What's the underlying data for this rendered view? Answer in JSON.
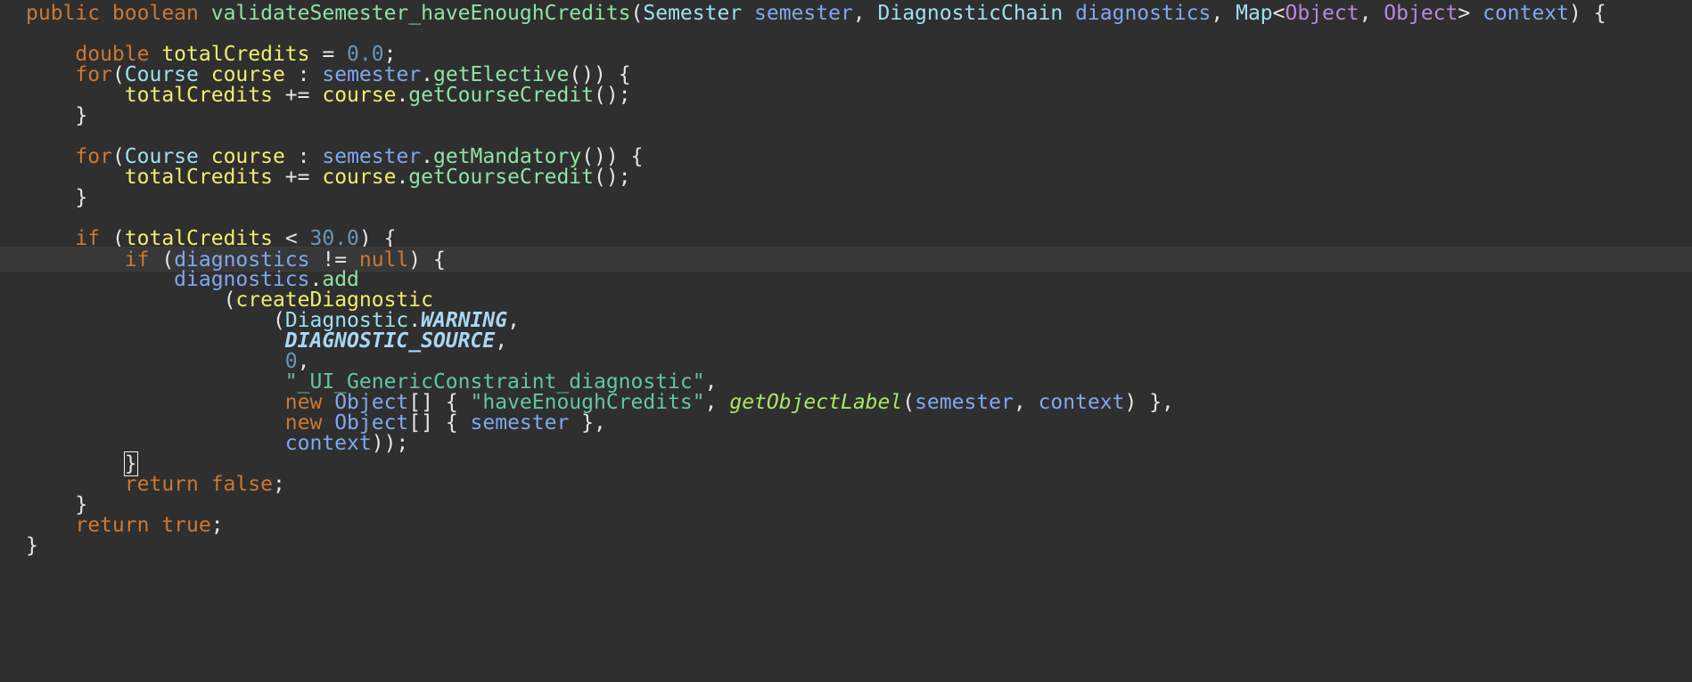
{
  "editor": {
    "lines": [
      {
        "current": false,
        "tokens": [
          {
            "t": "public boolean ",
            "c": "kw"
          },
          {
            "t": "validateSemester_haveEnoughCredits",
            "c": "meth"
          },
          {
            "t": "(",
            "c": "punc"
          },
          {
            "t": "Semester ",
            "c": "type"
          },
          {
            "t": "semester",
            "c": "param"
          },
          {
            "t": ", ",
            "c": "punc"
          },
          {
            "t": "DiagnosticChain ",
            "c": "type"
          },
          {
            "t": "diagnostics",
            "c": "param"
          },
          {
            "t": ", ",
            "c": "punc"
          },
          {
            "t": "Map",
            "c": "type"
          },
          {
            "t": "<",
            "c": "punc"
          },
          {
            "t": "Object",
            "c": "gen"
          },
          {
            "t": ", ",
            "c": "punc"
          },
          {
            "t": "Object",
            "c": "gen"
          },
          {
            "t": "> ",
            "c": "punc"
          },
          {
            "t": "context",
            "c": "param"
          },
          {
            "t": ") {",
            "c": "punc"
          }
        ]
      },
      {
        "current": false,
        "tokens": []
      },
      {
        "current": false,
        "tokens": [
          {
            "t": "    ",
            "c": "plain"
          },
          {
            "t": "double ",
            "c": "kw"
          },
          {
            "t": "totalCredits",
            "c": "var"
          },
          {
            "t": " = ",
            "c": "punc"
          },
          {
            "t": "0.0",
            "c": "num"
          },
          {
            "t": ";",
            "c": "punc"
          }
        ]
      },
      {
        "current": false,
        "tokens": [
          {
            "t": "    ",
            "c": "plain"
          },
          {
            "t": "for",
            "c": "kw"
          },
          {
            "t": "(",
            "c": "punc"
          },
          {
            "t": "Course ",
            "c": "type"
          },
          {
            "t": "course",
            "c": "var"
          },
          {
            "t": " : ",
            "c": "punc"
          },
          {
            "t": "semester",
            "c": "param"
          },
          {
            "t": ".",
            "c": "punc"
          },
          {
            "t": "getElective",
            "c": "meth"
          },
          {
            "t": "()) {",
            "c": "punc"
          }
        ]
      },
      {
        "current": false,
        "tokens": [
          {
            "t": "        ",
            "c": "plain"
          },
          {
            "t": "totalCredits",
            "c": "var"
          },
          {
            "t": " += ",
            "c": "punc"
          },
          {
            "t": "course",
            "c": "var"
          },
          {
            "t": ".",
            "c": "punc"
          },
          {
            "t": "getCourseCredit",
            "c": "meth"
          },
          {
            "t": "();",
            "c": "punc"
          }
        ]
      },
      {
        "current": false,
        "tokens": [
          {
            "t": "    }",
            "c": "punc"
          }
        ]
      },
      {
        "current": false,
        "tokens": []
      },
      {
        "current": false,
        "tokens": [
          {
            "t": "    ",
            "c": "plain"
          },
          {
            "t": "for",
            "c": "kw"
          },
          {
            "t": "(",
            "c": "punc"
          },
          {
            "t": "Course ",
            "c": "type"
          },
          {
            "t": "course",
            "c": "var"
          },
          {
            "t": " : ",
            "c": "punc"
          },
          {
            "t": "semester",
            "c": "param"
          },
          {
            "t": ".",
            "c": "punc"
          },
          {
            "t": "getMandatory",
            "c": "meth"
          },
          {
            "t": "()) {",
            "c": "punc"
          }
        ]
      },
      {
        "current": false,
        "tokens": [
          {
            "t": "        ",
            "c": "plain"
          },
          {
            "t": "totalCredits",
            "c": "var"
          },
          {
            "t": " += ",
            "c": "punc"
          },
          {
            "t": "course",
            "c": "var"
          },
          {
            "t": ".",
            "c": "punc"
          },
          {
            "t": "getCourseCredit",
            "c": "meth"
          },
          {
            "t": "();",
            "c": "punc"
          }
        ]
      },
      {
        "current": false,
        "tokens": [
          {
            "t": "    }",
            "c": "punc"
          }
        ]
      },
      {
        "current": false,
        "tokens": []
      },
      {
        "current": false,
        "tokens": [
          {
            "t": "    ",
            "c": "plain"
          },
          {
            "t": "if",
            "c": "kw"
          },
          {
            "t": " (",
            "c": "punc"
          },
          {
            "t": "totalCredits",
            "c": "var"
          },
          {
            "t": " < ",
            "c": "punc"
          },
          {
            "t": "30.0",
            "c": "num"
          },
          {
            "t": ") {",
            "c": "punc"
          }
        ]
      },
      {
        "current": true,
        "tokens": [
          {
            "t": "        ",
            "c": "plain"
          },
          {
            "t": "if",
            "c": "kw"
          },
          {
            "t": " (",
            "c": "punc"
          },
          {
            "t": "diagnostics",
            "c": "param"
          },
          {
            "t": " != ",
            "c": "punc"
          },
          {
            "t": "null",
            "c": "kw"
          },
          {
            "t": ") {",
            "c": "punc"
          }
        ]
      },
      {
        "current": false,
        "tokens": [
          {
            "t": "            ",
            "c": "plain"
          },
          {
            "t": "diagnostics",
            "c": "param"
          },
          {
            "t": ".",
            "c": "punc"
          },
          {
            "t": "add",
            "c": "meth"
          }
        ]
      },
      {
        "current": false,
        "tokens": [
          {
            "t": "                ",
            "c": "plain"
          },
          {
            "t": "(",
            "c": "punc"
          },
          {
            "t": "createDiagnostic",
            "c": "var"
          }
        ]
      },
      {
        "current": false,
        "tokens": [
          {
            "t": "                    ",
            "c": "plain"
          },
          {
            "t": "(",
            "c": "punc"
          },
          {
            "t": "Diagnostic",
            "c": "type"
          },
          {
            "t": ".",
            "c": "punc"
          },
          {
            "t": "WARNING",
            "c": "const"
          },
          {
            "t": ",",
            "c": "punc"
          }
        ]
      },
      {
        "current": false,
        "tokens": [
          {
            "t": "                     ",
            "c": "plain"
          },
          {
            "t": "DIAGNOSTIC_SOURCE",
            "c": "const"
          },
          {
            "t": ",",
            "c": "punc"
          }
        ]
      },
      {
        "current": false,
        "tokens": [
          {
            "t": "                     ",
            "c": "plain"
          },
          {
            "t": "0",
            "c": "num"
          },
          {
            "t": ",",
            "c": "punc"
          }
        ]
      },
      {
        "current": false,
        "tokens": [
          {
            "t": "                     ",
            "c": "plain"
          },
          {
            "t": "\"_UI_GenericConstraint_diagnostic\"",
            "c": "str"
          },
          {
            "t": ",",
            "c": "punc"
          }
        ]
      },
      {
        "current": false,
        "tokens": [
          {
            "t": "                     ",
            "c": "plain"
          },
          {
            "t": "new ",
            "c": "kw"
          },
          {
            "t": "Object",
            "c": "param"
          },
          {
            "t": "[] { ",
            "c": "punc"
          },
          {
            "t": "\"haveEnoughCredits\"",
            "c": "str"
          },
          {
            "t": ", ",
            "c": "punc"
          },
          {
            "t": "getObjectLabel",
            "c": "italmeth"
          },
          {
            "t": "(",
            "c": "punc"
          },
          {
            "t": "semester",
            "c": "param"
          },
          {
            "t": ", ",
            "c": "punc"
          },
          {
            "t": "context",
            "c": "param"
          },
          {
            "t": ") },",
            "c": "punc"
          }
        ]
      },
      {
        "current": false,
        "tokens": [
          {
            "t": "                     ",
            "c": "plain"
          },
          {
            "t": "new ",
            "c": "kw"
          },
          {
            "t": "Object",
            "c": "param"
          },
          {
            "t": "[] { ",
            "c": "punc"
          },
          {
            "t": "semester",
            "c": "param"
          },
          {
            "t": " },",
            "c": "punc"
          }
        ]
      },
      {
        "current": false,
        "tokens": [
          {
            "t": "                     ",
            "c": "plain"
          },
          {
            "t": "context",
            "c": "param"
          },
          {
            "t": "));",
            "c": "punc"
          }
        ]
      },
      {
        "current": false,
        "tokens": [
          {
            "t": "        ",
            "c": "plain"
          },
          {
            "t": "}",
            "c": "cursor"
          }
        ]
      },
      {
        "current": false,
        "tokens": [
          {
            "t": "        ",
            "c": "plain"
          },
          {
            "t": "return false",
            "c": "kw"
          },
          {
            "t": ";",
            "c": "punc"
          }
        ]
      },
      {
        "current": false,
        "tokens": [
          {
            "t": "    }",
            "c": "punc"
          }
        ]
      },
      {
        "current": false,
        "tokens": [
          {
            "t": "    ",
            "c": "plain"
          },
          {
            "t": "return true",
            "c": "kw"
          },
          {
            "t": ";",
            "c": "punc"
          }
        ]
      },
      {
        "current": false,
        "tokens": [
          {
            "t": "}",
            "c": "punc"
          }
        ]
      }
    ]
  }
}
